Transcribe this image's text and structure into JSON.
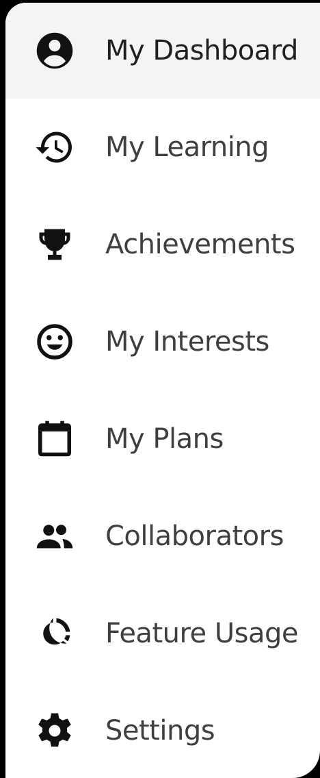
{
  "menu": {
    "items": [
      {
        "label": "My Dashboard",
        "icon": "account-circle-icon",
        "active": true
      },
      {
        "label": "My Learning",
        "icon": "history-icon",
        "active": false
      },
      {
        "label": "Achievements",
        "icon": "trophy-icon",
        "active": false
      },
      {
        "label": "My Interests",
        "icon": "smiley-icon",
        "active": false
      },
      {
        "label": "My Plans",
        "icon": "calendar-icon",
        "active": false
      },
      {
        "label": "Collaborators",
        "icon": "people-icon",
        "active": false
      },
      {
        "label": "Feature Usage",
        "icon": "donut-chart-icon",
        "active": false
      },
      {
        "label": "Settings",
        "icon": "gear-icon",
        "active": false
      }
    ]
  },
  "colors": {
    "background": "#000000",
    "panel": "#ffffff",
    "active_row": "#f4f4f4",
    "icon": "#111111",
    "text": "#3f3f3f"
  }
}
